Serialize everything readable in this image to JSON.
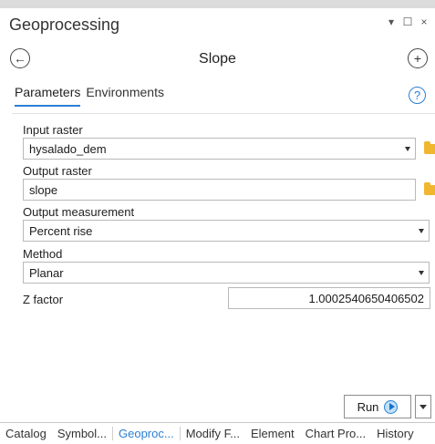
{
  "window": {
    "title": "Geoprocessing",
    "controls": {
      "pin": "▾",
      "restore": "☐",
      "close": "×"
    }
  },
  "tool": {
    "title": "Slope",
    "back_icon": "arrow-left-circle-icon",
    "add_icon": "plus-circle-icon"
  },
  "tabs": [
    {
      "label": "Parameters",
      "active": true
    },
    {
      "label": "Environments",
      "active": false
    }
  ],
  "help": {
    "icon": "question-circle-icon",
    "label": "?"
  },
  "params": {
    "input_raster": {
      "label": "Input raster",
      "value": "hysalado_dem"
    },
    "output_raster": {
      "label": "Output raster",
      "value": "slope"
    },
    "output_measurement": {
      "label": "Output measurement",
      "value": "Percent rise"
    },
    "method": {
      "label": "Method",
      "value": "Planar"
    },
    "z_factor": {
      "label": "Z factor",
      "value": "1.0002540650406502"
    }
  },
  "run": {
    "label": "Run"
  },
  "bottom_tabs": [
    {
      "label": "Catalog",
      "active": false
    },
    {
      "label": "Symbol...",
      "active": false
    },
    {
      "label": "Geoproc...",
      "active": true
    },
    {
      "label": "Modify F...",
      "active": false
    },
    {
      "label": "Element",
      "active": false
    },
    {
      "label": "Chart Pro...",
      "active": false
    },
    {
      "label": "History",
      "active": false
    }
  ],
  "colors": {
    "accent": "#2a7fd4",
    "folder": "#f1b62f"
  }
}
